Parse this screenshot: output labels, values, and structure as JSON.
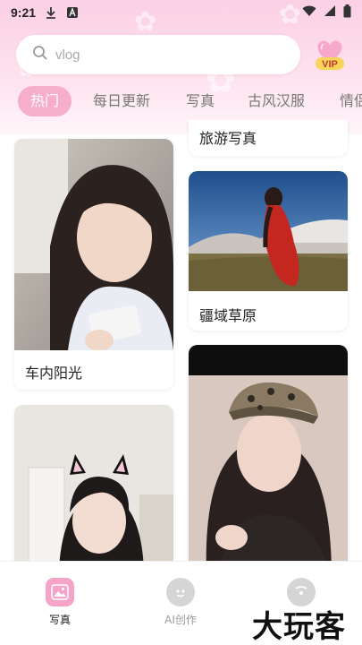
{
  "status_bar": {
    "time": "9:21",
    "icons": [
      "download-icon",
      "app-a-icon",
      "wifi-icon",
      "signal-icon",
      "battery-icon"
    ]
  },
  "search": {
    "placeholder": "vlog",
    "icon": "search-icon"
  },
  "vip": {
    "label": "VIP"
  },
  "tabs": [
    {
      "label": "热门",
      "active": true
    },
    {
      "label": "每日更新",
      "active": false
    },
    {
      "label": "写真",
      "active": false
    },
    {
      "label": "古风汉服",
      "active": false
    },
    {
      "label": "情侣",
      "active": false
    }
  ],
  "feed": {
    "left": [
      {
        "caption": "车内阳光",
        "image": "girl-in-car-photo"
      },
      {
        "caption": "",
        "image": "girl-with-cat-ears-photo"
      }
    ],
    "right": [
      {
        "caption": "旅游写真",
        "image": ""
      },
      {
        "caption": "疆域草原",
        "image": "girl-red-dress-grassland-photo"
      },
      {
        "caption": "",
        "image": "girl-with-cap-photo"
      }
    ]
  },
  "bottom_nav": [
    {
      "label": "写真",
      "icon": "photo-icon",
      "active": true
    },
    {
      "label": "AI创作",
      "icon": "ai-face-icon",
      "active": false
    },
    {
      "label": "",
      "icon": "chat-icon",
      "active": false
    }
  ],
  "watermark": "大玩客",
  "colors": {
    "accent": "#f6aecb",
    "header_gradient_top": "#fbd0e4",
    "nav_active": "#f5a3c7"
  }
}
